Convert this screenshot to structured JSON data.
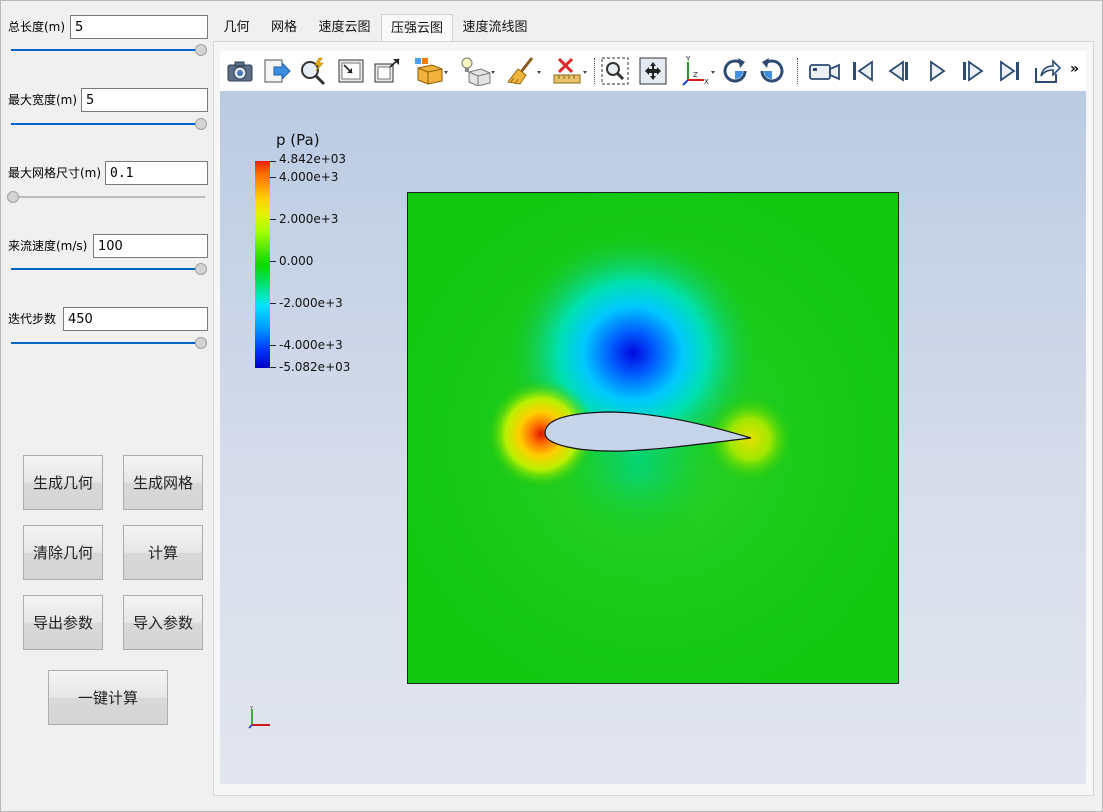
{
  "left_panel": {
    "params": [
      {
        "label": "总长度(m)",
        "value": "5",
        "slider_fraction": 1.0
      },
      {
        "label": "最大宽度(m)",
        "value": "5",
        "slider_fraction": 1.0
      },
      {
        "label": "最大网格尺寸(m)",
        "value": "0.1",
        "slider_fraction": 0.0
      },
      {
        "label": "来流速度(m/s)",
        "value": "100",
        "slider_fraction": 1.0
      },
      {
        "label": "迭代步数",
        "value": "450",
        "slider_fraction": 1.0
      }
    ],
    "buttons": {
      "generate_geometry": "生成几何",
      "generate_mesh": "生成网格",
      "clear_geometry": "清除几何",
      "compute": "计算",
      "export_params": "导出参数",
      "import_params": "导入参数",
      "one_click_compute": "一键计算"
    }
  },
  "tabs": [
    {
      "label": "几何",
      "active": false
    },
    {
      "label": "网格",
      "active": false
    },
    {
      "label": "速度云图",
      "active": false
    },
    {
      "label": "压强云图",
      "active": true
    },
    {
      "label": "速度流线图",
      "active": false
    }
  ],
  "toolbar": {
    "icons": [
      "camera-icon",
      "export-arrow-icon",
      "magnify-zap-icon",
      "zoom-box-icon",
      "expand-box-icon",
      "color-cube-icon",
      "light-cube-icon",
      "broom-icon",
      "delete-ruler-icon",
      "zoom-select-icon",
      "fit-view-icon",
      "axes-icon",
      "rotate-cw-icon",
      "rotate-ccw-icon",
      "camera-record-icon",
      "first-frame-icon",
      "step-back-icon",
      "play-icon",
      "step-forward-icon",
      "last-frame-icon",
      "share-icon"
    ],
    "overflow_label": "»"
  },
  "legend": {
    "title": "p (Pa)",
    "max_label": "4.842e+03",
    "min_label": "-5.082e+03",
    "ticks": [
      "4.000e+3",
      "2.000e+3",
      "0.000",
      "-2.000e+3",
      "-4.000e+3"
    ],
    "colormap": "rainbow"
  },
  "colors": {
    "slider_fill": "#0063c8",
    "field_green": "#12c810",
    "viewport_top": "#bacbe3",
    "viewport_bottom": "#e3e6ef"
  }
}
